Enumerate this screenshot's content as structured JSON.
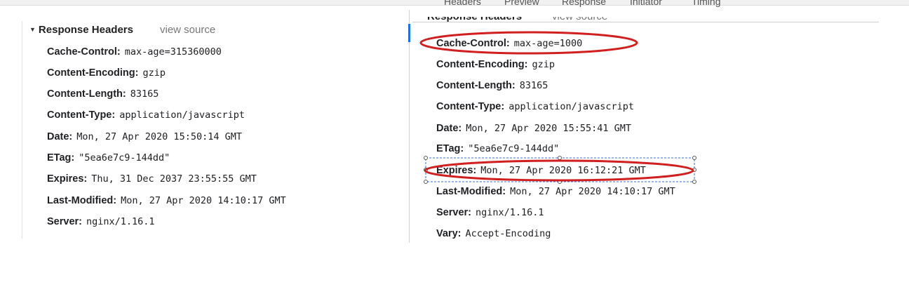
{
  "left_panel": {
    "section_title": "Response Headers",
    "view_source": "view source",
    "headers": [
      {
        "name": "Cache-Control:",
        "value": "max-age=315360000"
      },
      {
        "name": "Content-Encoding:",
        "value": "gzip"
      },
      {
        "name": "Content-Length:",
        "value": "83165"
      },
      {
        "name": "Content-Type:",
        "value": "application/javascript"
      },
      {
        "name": "Date:",
        "value": "Mon, 27 Apr 2020 15:50:14 GMT"
      },
      {
        "name": "ETag:",
        "value": "\"5ea6e7c9-144dd\""
      },
      {
        "name": "Expires:",
        "value": "Thu, 31 Dec 2037 23:55:55 GMT"
      },
      {
        "name": "Last-Modified:",
        "value": "Mon, 27 Apr 2020 14:10:17 GMT"
      },
      {
        "name": "Server:",
        "value": "nginx/1.16.1"
      }
    ]
  },
  "right_panel": {
    "tabs": [
      "Headers",
      "Preview",
      "Response",
      "Initiator",
      "Timing"
    ],
    "section_title": "Response Headers",
    "view_source": "view source",
    "headers": [
      {
        "name": "Cache-Control:",
        "value": "max-age=1000"
      },
      {
        "name": "Content-Encoding:",
        "value": "gzip"
      },
      {
        "name": "Content-Length:",
        "value": "83165"
      },
      {
        "name": "Content-Type:",
        "value": "application/javascript"
      },
      {
        "name": "Date:",
        "value": "Mon, 27 Apr 2020 15:55:41 GMT"
      },
      {
        "name": "ETag:",
        "value": "\"5ea6e7c9-144dd\""
      },
      {
        "name": "Expires:",
        "value": "Mon, 27 Apr 2020 16:12:21 GMT"
      },
      {
        "name": "Last-Modified:",
        "value": "Mon, 27 Apr 2020 14:10:17 GMT"
      },
      {
        "name": "Server:",
        "value": "nginx/1.16.1"
      },
      {
        "name": "Vary:",
        "value": "Accept-Encoding"
      }
    ]
  },
  "annotations": {
    "ellipse_color": "#d11f1f",
    "selection_color": "#3a6fd8"
  }
}
